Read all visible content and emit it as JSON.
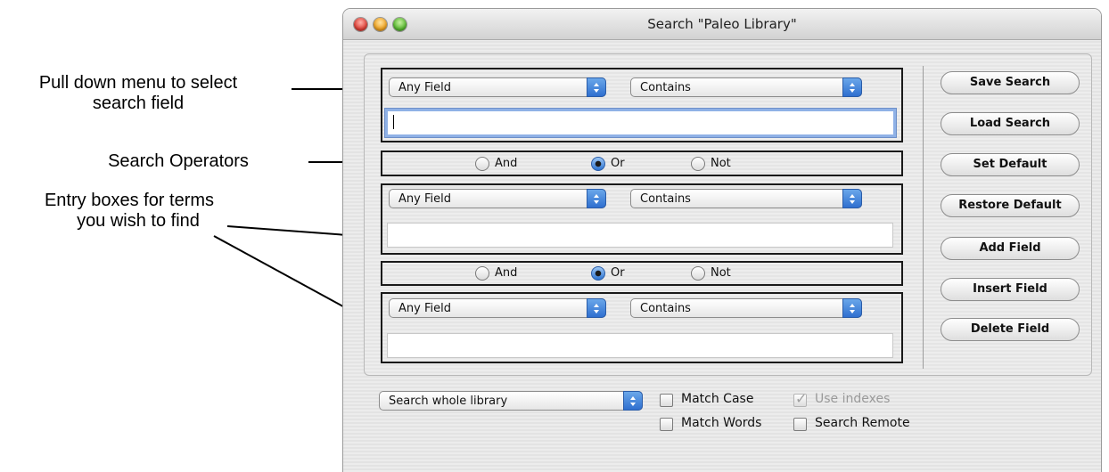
{
  "annotations": {
    "pulldown": [
      "Pull down menu to select",
      "search field"
    ],
    "operators": "Search Operators",
    "entry": [
      "Entry boxes for terms",
      "you wish to find"
    ]
  },
  "window": {
    "title": "Search \"Paleo Library\""
  },
  "rows": [
    {
      "field": "Any Field",
      "operator": "Contains",
      "value": ""
    },
    {
      "field": "Any Field",
      "operator": "Contains",
      "value": ""
    },
    {
      "field": "Any Field",
      "operator": "Contains",
      "value": ""
    }
  ],
  "connectors": [
    {
      "and": "And",
      "or": "Or",
      "not": "Not",
      "selected": "Or"
    },
    {
      "and": "And",
      "or": "Or",
      "not": "Not",
      "selected": "Or"
    }
  ],
  "buttons": {
    "save": "Save Search",
    "load": "Load Search",
    "set_default": "Set Default",
    "restore_default": "Restore Default",
    "add_field": "Add Field",
    "insert_field": "Insert Field",
    "delete_field": "Delete Field"
  },
  "bottom": {
    "scope": "Search whole library",
    "match_case": "Match Case",
    "match_words": "Match Words",
    "use_indexes": "Use indexes",
    "search_remote": "Search Remote"
  },
  "colors": {
    "popup_arrow": "#2f6fcf",
    "focus_ring": "#8fb1e6",
    "radio_selected": "#2f74d0"
  }
}
